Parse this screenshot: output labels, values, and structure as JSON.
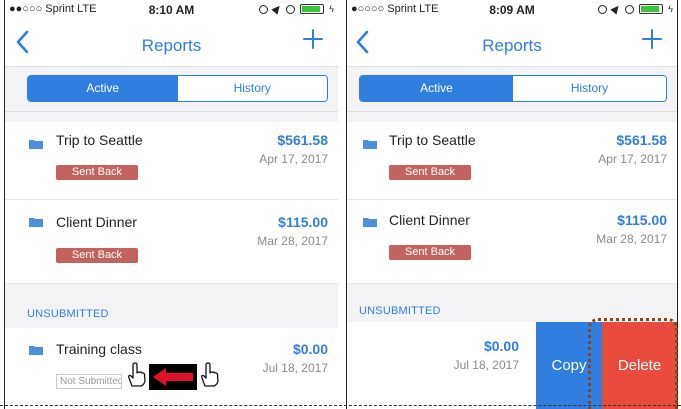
{
  "left_screen": {
    "status": {
      "carrier": "●●○○○ Sprint  LTE",
      "time": "8:10 AM"
    },
    "nav": {
      "title": "Reports"
    },
    "tabs": [
      {
        "label": "Active"
      },
      {
        "label": "History"
      }
    ],
    "reports": [
      {
        "name": "Trip to Seattle",
        "amount": "$561.58",
        "date": "Apr 17, 2017",
        "status": "Sent Back"
      },
      {
        "name": "Client Dinner",
        "amount": "$115.00",
        "date": "Mar 28, 2017",
        "status": "Sent Back"
      }
    ],
    "section_header": "UNSUBMITTED",
    "unsubmitted": {
      "name": "Training class",
      "amount": "$0.00",
      "date": "Jul 18, 2017",
      "status": "Not Submitted"
    }
  },
  "right_screen": {
    "status": {
      "carrier": "●○○○○ Sprint  LTE",
      "time": "8:09 AM"
    },
    "nav": {
      "title": "Reports"
    },
    "tabs": [
      {
        "label": "Active"
      },
      {
        "label": "History"
      }
    ],
    "reports": [
      {
        "name": "Trip to Seattle",
        "amount": "$561.58",
        "date": "Apr 17, 2017",
        "status": "Sent Back"
      },
      {
        "name": "Client Dinner",
        "amount": "$115.00",
        "date": "Mar 28, 2017",
        "status": "Sent Back"
      }
    ],
    "section_header": "UNSUBMITTED",
    "unsubmitted": {
      "amount": "$0.00",
      "date": "Jul 18, 2017"
    },
    "actions": {
      "copy": "Copy",
      "delete": "Delete"
    }
  },
  "colors": {
    "accent": "#2f7ee0",
    "sent_back": "#c2635f",
    "delete": "#e94b3c",
    "battery": "#37c837",
    "highlight_box": "#8b4513"
  },
  "icons": [
    "back-chevron-icon",
    "plus-icon",
    "folder-icon",
    "alarm-icon",
    "location-arrow-icon",
    "battery-icon",
    "pointing-hand-icon",
    "swipe-left-arrow-icon"
  ]
}
